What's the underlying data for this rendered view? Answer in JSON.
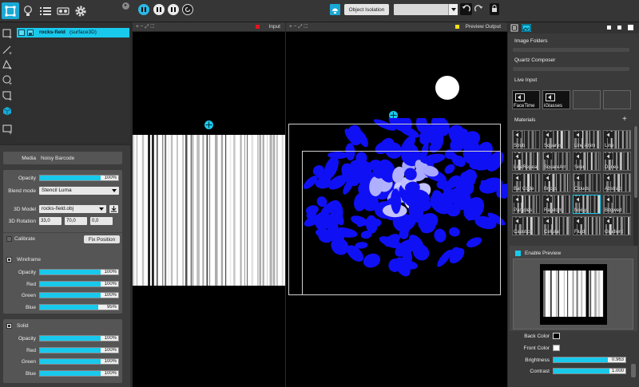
{
  "toolbar": {
    "object_isolation": "Object Isolation",
    "dropdown_value": ""
  },
  "layers": {
    "item_name": "rocks-field",
    "item_type": "(surface3D)"
  },
  "media": {
    "label": "Media",
    "value": "Noisy Barcode"
  },
  "main": {
    "opacity_label": "Opacity",
    "opacity": 1.0,
    "opacity_text": "100%",
    "blend_label": "Blend mode",
    "blend_value": "Stencil Luma",
    "model_label": "3D Model",
    "model_value": "rocks-field.obj",
    "rotation_label": "3D Rotation",
    "rot_x": "33,0",
    "rot_y": "70,0",
    "rot_z": "0,0",
    "calibrate_label": "Calibrate",
    "fix_position_label": "Fix Position"
  },
  "wireframe": {
    "title": "Wireframe",
    "rows": [
      {
        "label": "Opacity",
        "value": 1.0,
        "text": "100%"
      },
      {
        "label": "Red",
        "value": 1.0,
        "text": "100%"
      },
      {
        "label": "Green",
        "value": 1.0,
        "text": "100%"
      },
      {
        "label": "Blue",
        "value": 0.95,
        "text": "95%"
      }
    ]
  },
  "solid": {
    "title": "Solid",
    "rows": [
      {
        "label": "Opacity",
        "value": 1.0,
        "text": "100%"
      },
      {
        "label": "Red",
        "value": 1.0,
        "text": "100%"
      },
      {
        "label": "Green",
        "value": 1.0,
        "text": "100%"
      },
      {
        "label": "Blue",
        "value": 1.0,
        "text": "100%"
      }
    ]
  },
  "input_view": {
    "title": "Input",
    "dot_color": "#e0161c",
    "controls": "+ − ⤢ ⬚"
  },
  "output_view": {
    "title": "Preview Output",
    "dot_color": "#f0e01a",
    "controls": "+ − ⤢ ⬚"
  },
  "right": {
    "image_folders": "Image Folders",
    "quartz": "Quartz Composer",
    "live_input": "Live Input",
    "live_items": [
      "FaceTime",
      "iGlasses"
    ],
    "materials": "Materials",
    "material_items": [
      "Strob",
      "Squares",
      "Line Anim",
      "Line",
      "LineRepea",
      "SquareArr",
      "Siren",
      "Dunes",
      "Bar Code",
      "Bricks",
      "Clouds",
      "Abstract",
      "Particles",
      "Random",
      "Noisy",
      "Bitgwed",
      "Caustics",
      "Cellular",
      "Fluid",
      "Gradient"
    ],
    "enable_preview": "Enable Preview",
    "back_color_label": "Back Color",
    "front_color_label": "Front Color",
    "brightness_label": "Brightness",
    "brightness": 0.963,
    "brightness_text": "0.963",
    "contrast_label": "Contrast",
    "contrast": 1.0,
    "contrast_text": "1.000"
  },
  "colors": {
    "accent": "#19c9ec",
    "blob": "#1010f5"
  }
}
